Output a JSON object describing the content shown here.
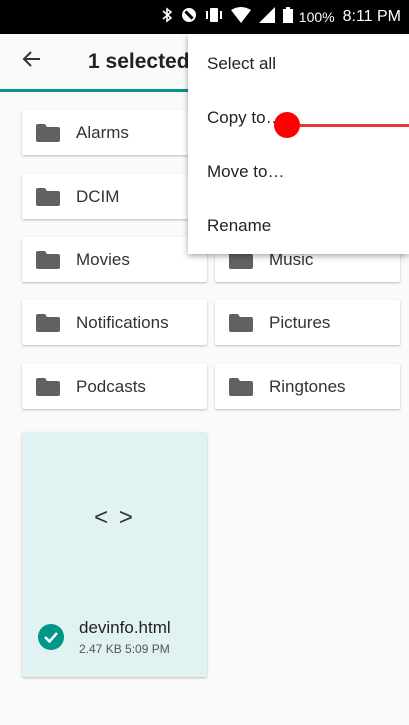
{
  "status_bar": {
    "battery_percent": "100%",
    "time": "8:11 PM",
    "icons": [
      "bluetooth-icon",
      "do-not-disturb-icon",
      "vibrate-icon",
      "wifi-icon",
      "signal-icon",
      "battery-icon"
    ]
  },
  "app_bar": {
    "back_icon": "arrow-back-icon",
    "title": "1 selected",
    "accent_color": "#009688"
  },
  "folders": [
    {
      "label": "Alarms"
    },
    {
      "label": "DCIM"
    },
    {
      "label": "Movies"
    },
    {
      "label": "Music"
    },
    {
      "label": "Notifications"
    },
    {
      "label": "Pictures"
    },
    {
      "label": "Podcasts"
    },
    {
      "label": "Ringtones"
    }
  ],
  "file": {
    "icon": "code-icon",
    "icon_glyph": "< >",
    "name": "devinfo.html",
    "meta": "2.47 KB 5:09 PM",
    "selected": true,
    "highlight_color": "#e0f2f1",
    "check_color": "#009688"
  },
  "overflow_menu": {
    "items": [
      {
        "label": "Select all"
      },
      {
        "label": "Copy to…"
      },
      {
        "label": "Move to…"
      },
      {
        "label": "Rename"
      }
    ]
  },
  "touch_indicator_color": "#ff0000"
}
